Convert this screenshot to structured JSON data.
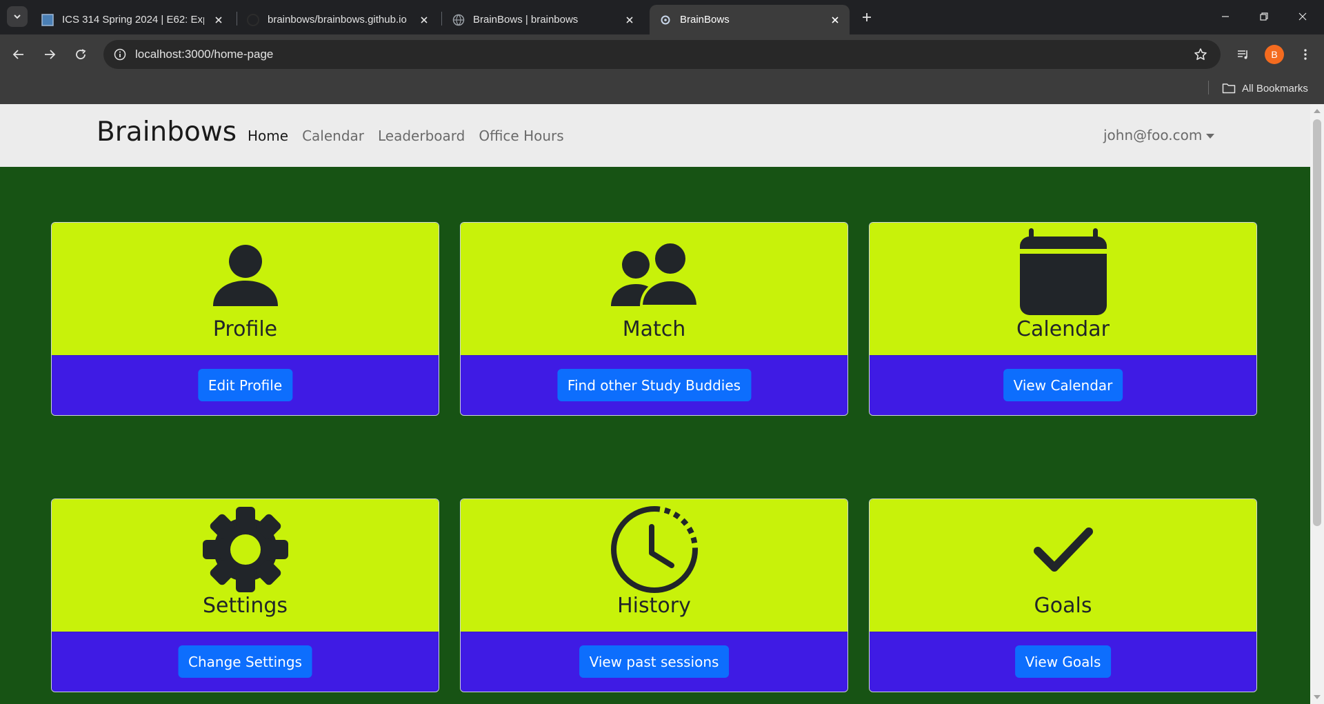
{
  "browser": {
    "tabs": [
      {
        "title": "ICS 314 Spring 2024 | E62: Exp",
        "active": false
      },
      {
        "title": "brainbows/brainbows.github.io",
        "active": false
      },
      {
        "title": "BrainBows | brainbows",
        "active": false
      },
      {
        "title": "BrainBows",
        "active": true
      }
    ],
    "url": "localhost:3000/home-page",
    "profile_initial": "B",
    "bookmarks_label": "All Bookmarks"
  },
  "navbar": {
    "brand": "Brainbows",
    "links": [
      "Home",
      "Calendar",
      "Leaderboard",
      "Office Hours"
    ],
    "active_link": "Home",
    "user_email": "john@foo.com"
  },
  "cards": [
    {
      "title": "Profile",
      "icon": "person-icon",
      "button": "Edit Profile"
    },
    {
      "title": "Match",
      "icon": "people-icon",
      "button": "Find other Study Buddies"
    },
    {
      "title": "Calendar",
      "icon": "calendar-icon",
      "button": "View Calendar"
    },
    {
      "title": "Settings",
      "icon": "gear-icon",
      "button": "Change Settings"
    },
    {
      "title": "History",
      "icon": "clock-history-icon",
      "button": "View past sessions"
    },
    {
      "title": "Goals",
      "icon": "check-icon",
      "button": "View Goals"
    }
  ],
  "colors": {
    "page_background": "#175314",
    "card_top": "#c8f20a",
    "card_bottom": "#3f1be4",
    "button": "#0d6efd",
    "navbar": "#ececec"
  }
}
